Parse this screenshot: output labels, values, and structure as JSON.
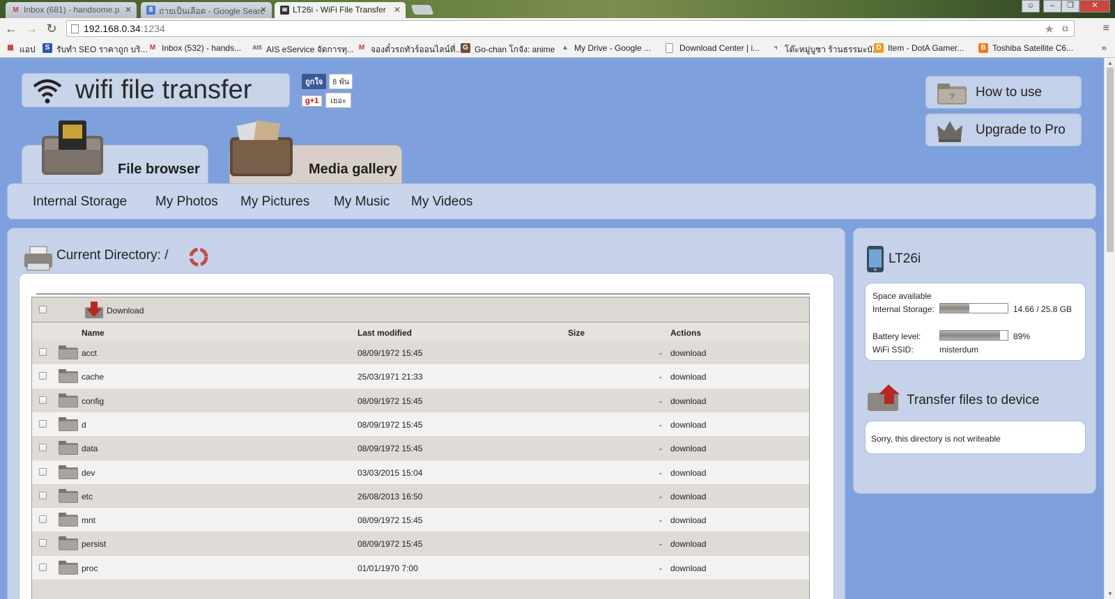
{
  "browser": {
    "tabs": [
      {
        "title": "Inbox (681) - handsome.p",
        "icon": "gmail-icon"
      },
      {
        "title": "ถ่ายเป็นเลือด - Google Searc",
        "icon": "google-icon"
      },
      {
        "title": "LT26i - WiFi File Transfer",
        "icon": "wifi-icon"
      }
    ],
    "url_host": "192.168.0.34",
    "url_port": ":1234",
    "bookmarks": [
      {
        "label": "แอป"
      },
      {
        "label": "รับทำ SEO ราคาถูก บริ..."
      },
      {
        "label": "Inbox (532) - hands..."
      },
      {
        "label": "AIS eService จัดการทุ..."
      },
      {
        "label": "จองตั๋วรถทัวร์ออนไลน์ที่..."
      },
      {
        "label": "Go-chan โกจัง: anime"
      },
      {
        "label": "My Drive - Google ..."
      },
      {
        "label": "Download Center | i..."
      },
      {
        "label": "โต๊ะหมู่บูชา ร้านธรรมะบั..."
      },
      {
        "label": "Item - DotA Gamer..."
      },
      {
        "label": "Toshiba Satellite C6..."
      }
    ],
    "bookmarks_more": "»"
  },
  "app": {
    "logo_text": "wifi file transfer",
    "fb_like": "ถูกใจ",
    "fb_count": "8 พัน",
    "gplus": "g+1",
    "gplus_count": "เยอะ",
    "how_to_use": "How to use",
    "upgrade": "Upgrade to Pro",
    "tabs": {
      "file_browser": "File browser",
      "media_gallery": "Media gallery"
    },
    "subnav": [
      "Internal Storage",
      "My Photos",
      "My Pictures",
      "My Music",
      "My Videos"
    ]
  },
  "browser_panel": {
    "current_directory_label": "Current Directory:",
    "current_path": "/",
    "download_label": "Download",
    "columns": {
      "name": "Name",
      "last_modified": "Last modified",
      "size": "Size",
      "actions": "Actions"
    },
    "rows": [
      {
        "name": "acct",
        "modified": "08/09/1972 15:45",
        "size": "-",
        "action": "download"
      },
      {
        "name": "cache",
        "modified": "25/03/1971 21:33",
        "size": "-",
        "action": "download"
      },
      {
        "name": "config",
        "modified": "08/09/1972 15:45",
        "size": "-",
        "action": "download"
      },
      {
        "name": "d",
        "modified": "08/09/1972 15:45",
        "size": "-",
        "action": "download"
      },
      {
        "name": "data",
        "modified": "08/09/1972 15:45",
        "size": "-",
        "action": "download"
      },
      {
        "name": "dev",
        "modified": "03/03/2015 15:04",
        "size": "-",
        "action": "download"
      },
      {
        "name": "etc",
        "modified": "26/08/2013 16:50",
        "size": "-",
        "action": "download"
      },
      {
        "name": "mnt",
        "modified": "08/09/1972 15:45",
        "size": "-",
        "action": "download"
      },
      {
        "name": "persist",
        "modified": "08/09/1972 15:45",
        "size": "-",
        "action": "download"
      },
      {
        "name": "proc",
        "modified": "01/01/1970 7:00",
        "size": "-",
        "action": "download"
      }
    ]
  },
  "device": {
    "name": "LT26i",
    "space_available_label": "Space available",
    "internal_storage_label": "Internal Storage:",
    "internal_storage_value": "14.66 / 25.8 GB",
    "storage_used_fraction": 0.43,
    "battery_label": "Battery level:",
    "battery_value": "89%",
    "battery_fraction": 0.89,
    "wifi_label": "WiFi SSID:",
    "wifi_value": "misterdum",
    "transfer_title": "Transfer files to device",
    "transfer_message": "Sorry, this directory is not writeable"
  }
}
